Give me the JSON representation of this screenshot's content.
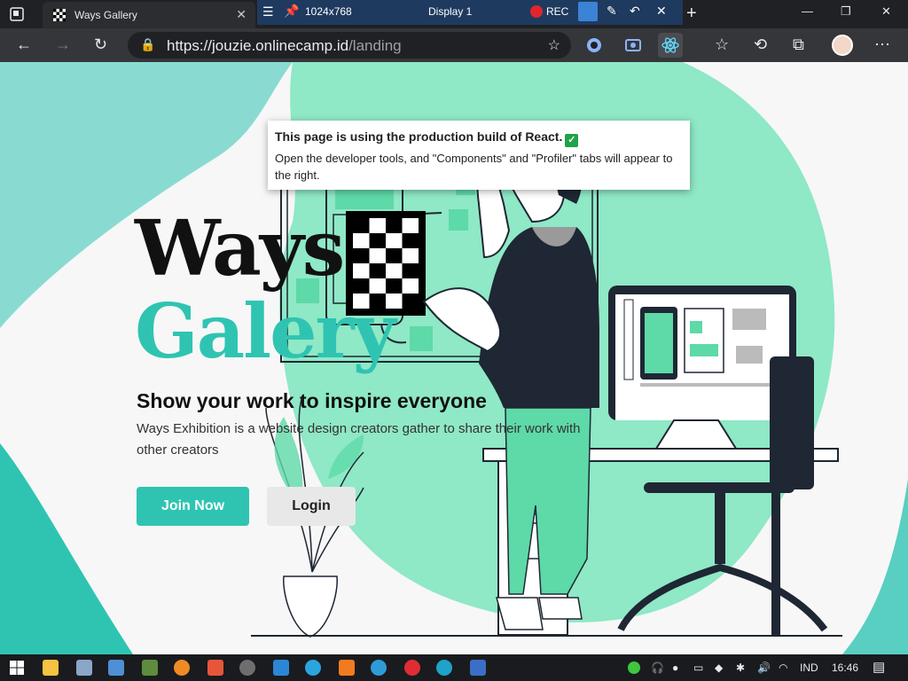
{
  "browser": {
    "tab_title": "Ways Gallery",
    "tab_close": "✕",
    "new_tab": "+",
    "url_host": "https://jouzie.onlinecamp.id",
    "url_path": "/landing",
    "window_controls": [
      "—",
      "❐",
      "✕"
    ]
  },
  "recorder": {
    "resolution": "1024x768",
    "display": "Display 1",
    "rec_label": "REC"
  },
  "react_popup": {
    "heading": "This page is using the production build of React.",
    "check": "✓",
    "body": "Open the developer tools, and \"Components\" and \"Profiler\" tabs will appear to the right."
  },
  "hero": {
    "title_line1": "Ways",
    "title_line2": "Galery",
    "subtitle": "Show your work to inspire everyone",
    "description": "Ways Exhibition is a website design creators gather to share their work with other creators",
    "join_label": "Join Now",
    "login_label": "Login"
  },
  "taskbar": {
    "language": "IND",
    "time": "16:46"
  },
  "colors": {
    "accent": "#2fc4b2",
    "blob": "#8fe8c6",
    "dark": "#1e2733"
  }
}
